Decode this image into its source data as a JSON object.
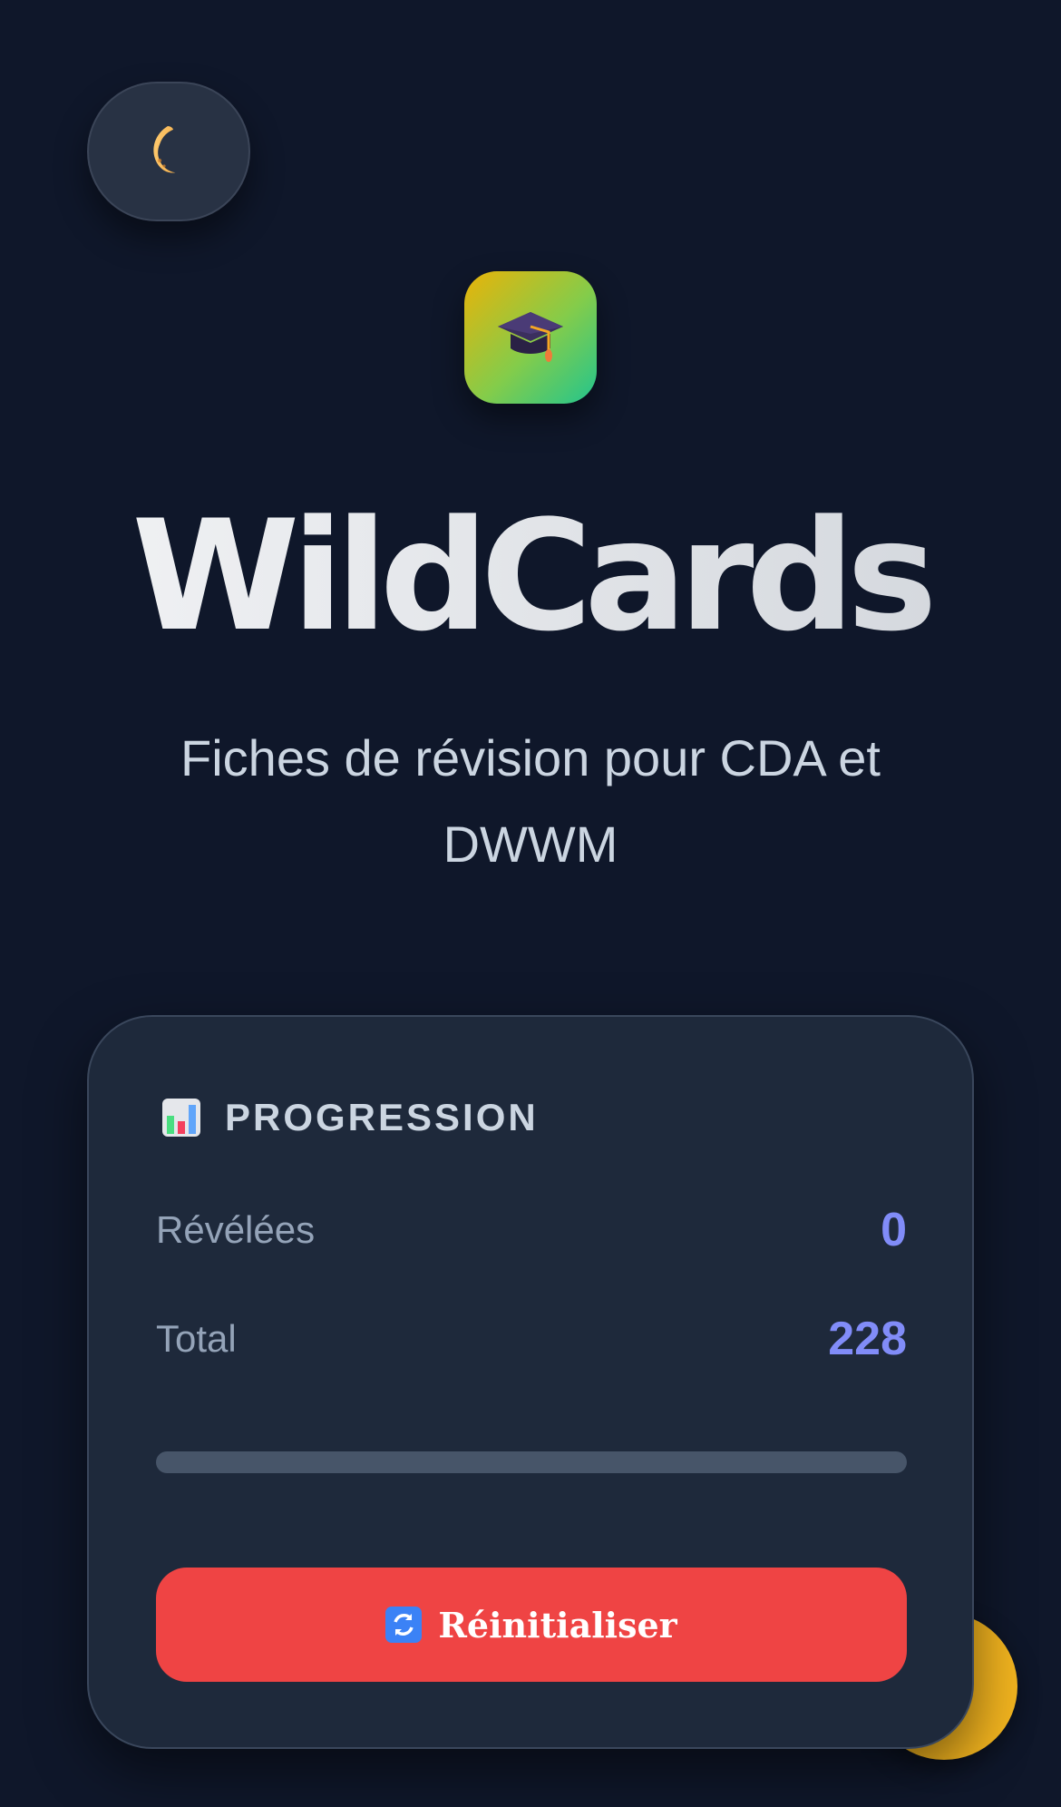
{
  "app": {
    "title": "WildCards",
    "subtitle": "Fiches de révision pour CDA et DWWM",
    "logo_icon": "graduation-cap-icon"
  },
  "theme_toggle": {
    "icon": "crescent-moon-icon"
  },
  "progress_card": {
    "title": "PROGRESSION",
    "title_icon": "bar-chart-icon",
    "revealed_label": "Révélées",
    "revealed_value": "0",
    "total_label": "Total",
    "total_value": "228",
    "progress_fraction": 0,
    "reset_label": "Réinitialiser",
    "reset_icon": "refresh-icon"
  },
  "colors": {
    "background": "#0f172a",
    "card": "#1e293b",
    "accent": "#818cf8",
    "danger": "#ef4444",
    "fab": "#f2b41f"
  }
}
